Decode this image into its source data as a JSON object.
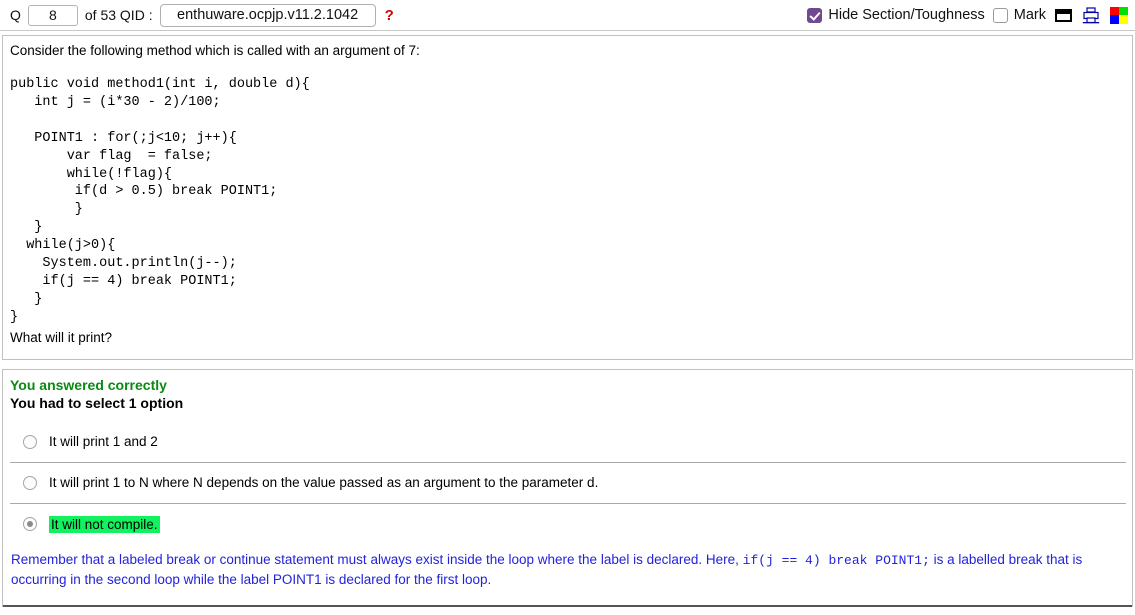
{
  "toolbar": {
    "q_label": "Q",
    "q_number": "8",
    "of_label": "of 53 QID :",
    "qid_value": "enthuware.ocpjp.v11.2.1042",
    "qid_placeholder": "enthuware.ocpjp.v11.2.1042",
    "help_mark": "?",
    "hide_section_label": "Hide Section/Toughness",
    "hide_section_checked": true,
    "mark_label": "Mark",
    "mark_checked": false,
    "icons": {
      "window": "window-icon",
      "printer": "printer-icon",
      "colors": "color-palette-icon"
    },
    "color_swatches": [
      "#ff0000",
      "#00e000",
      "#0000ff",
      "#ffff00"
    ],
    "accent_checkbox": "#6f4a8e",
    "help_color": "#d40000"
  },
  "question": {
    "intro": "Consider the following method which is called with an argument of 7:",
    "code": "public void method1(int i, double d){\n   int j = (i*30 - 2)/100;\n\n   POINT1 : for(;j<10; j++){\n       var flag  = false;\n       while(!flag){\n        if(d > 0.5) break POINT1;\n        }\n   }\n  while(j>0){\n    System.out.println(j--);\n    if(j == 4) break POINT1;\n   }\n}",
    "outro": "What will it print?"
  },
  "answer_section": {
    "result_text": "You answered correctly",
    "result_color": "#0a8a12",
    "instruction_text": "You had to select 1 option",
    "options": [
      {
        "label": "It will print 1 and 2",
        "selected": false,
        "highlighted": false
      },
      {
        "label": "It will print 1 to N where N depends on the value passed as an argument to the parameter d.",
        "selected": false,
        "highlighted": false
      },
      {
        "label": "It will not compile.",
        "selected": true,
        "highlighted": true
      }
    ],
    "highlight_color": "#11f25e",
    "explanation": {
      "part1": "Remember that a labeled break or continue statement must always exist inside the loop where the label is declared. Here, ",
      "code1": "if(j == 4) break POINT1;",
      "part2": " is a labelled break that is occurring in the second loop while the label POINT1 is declared for the first loop.",
      "color": "#2222dd"
    }
  }
}
